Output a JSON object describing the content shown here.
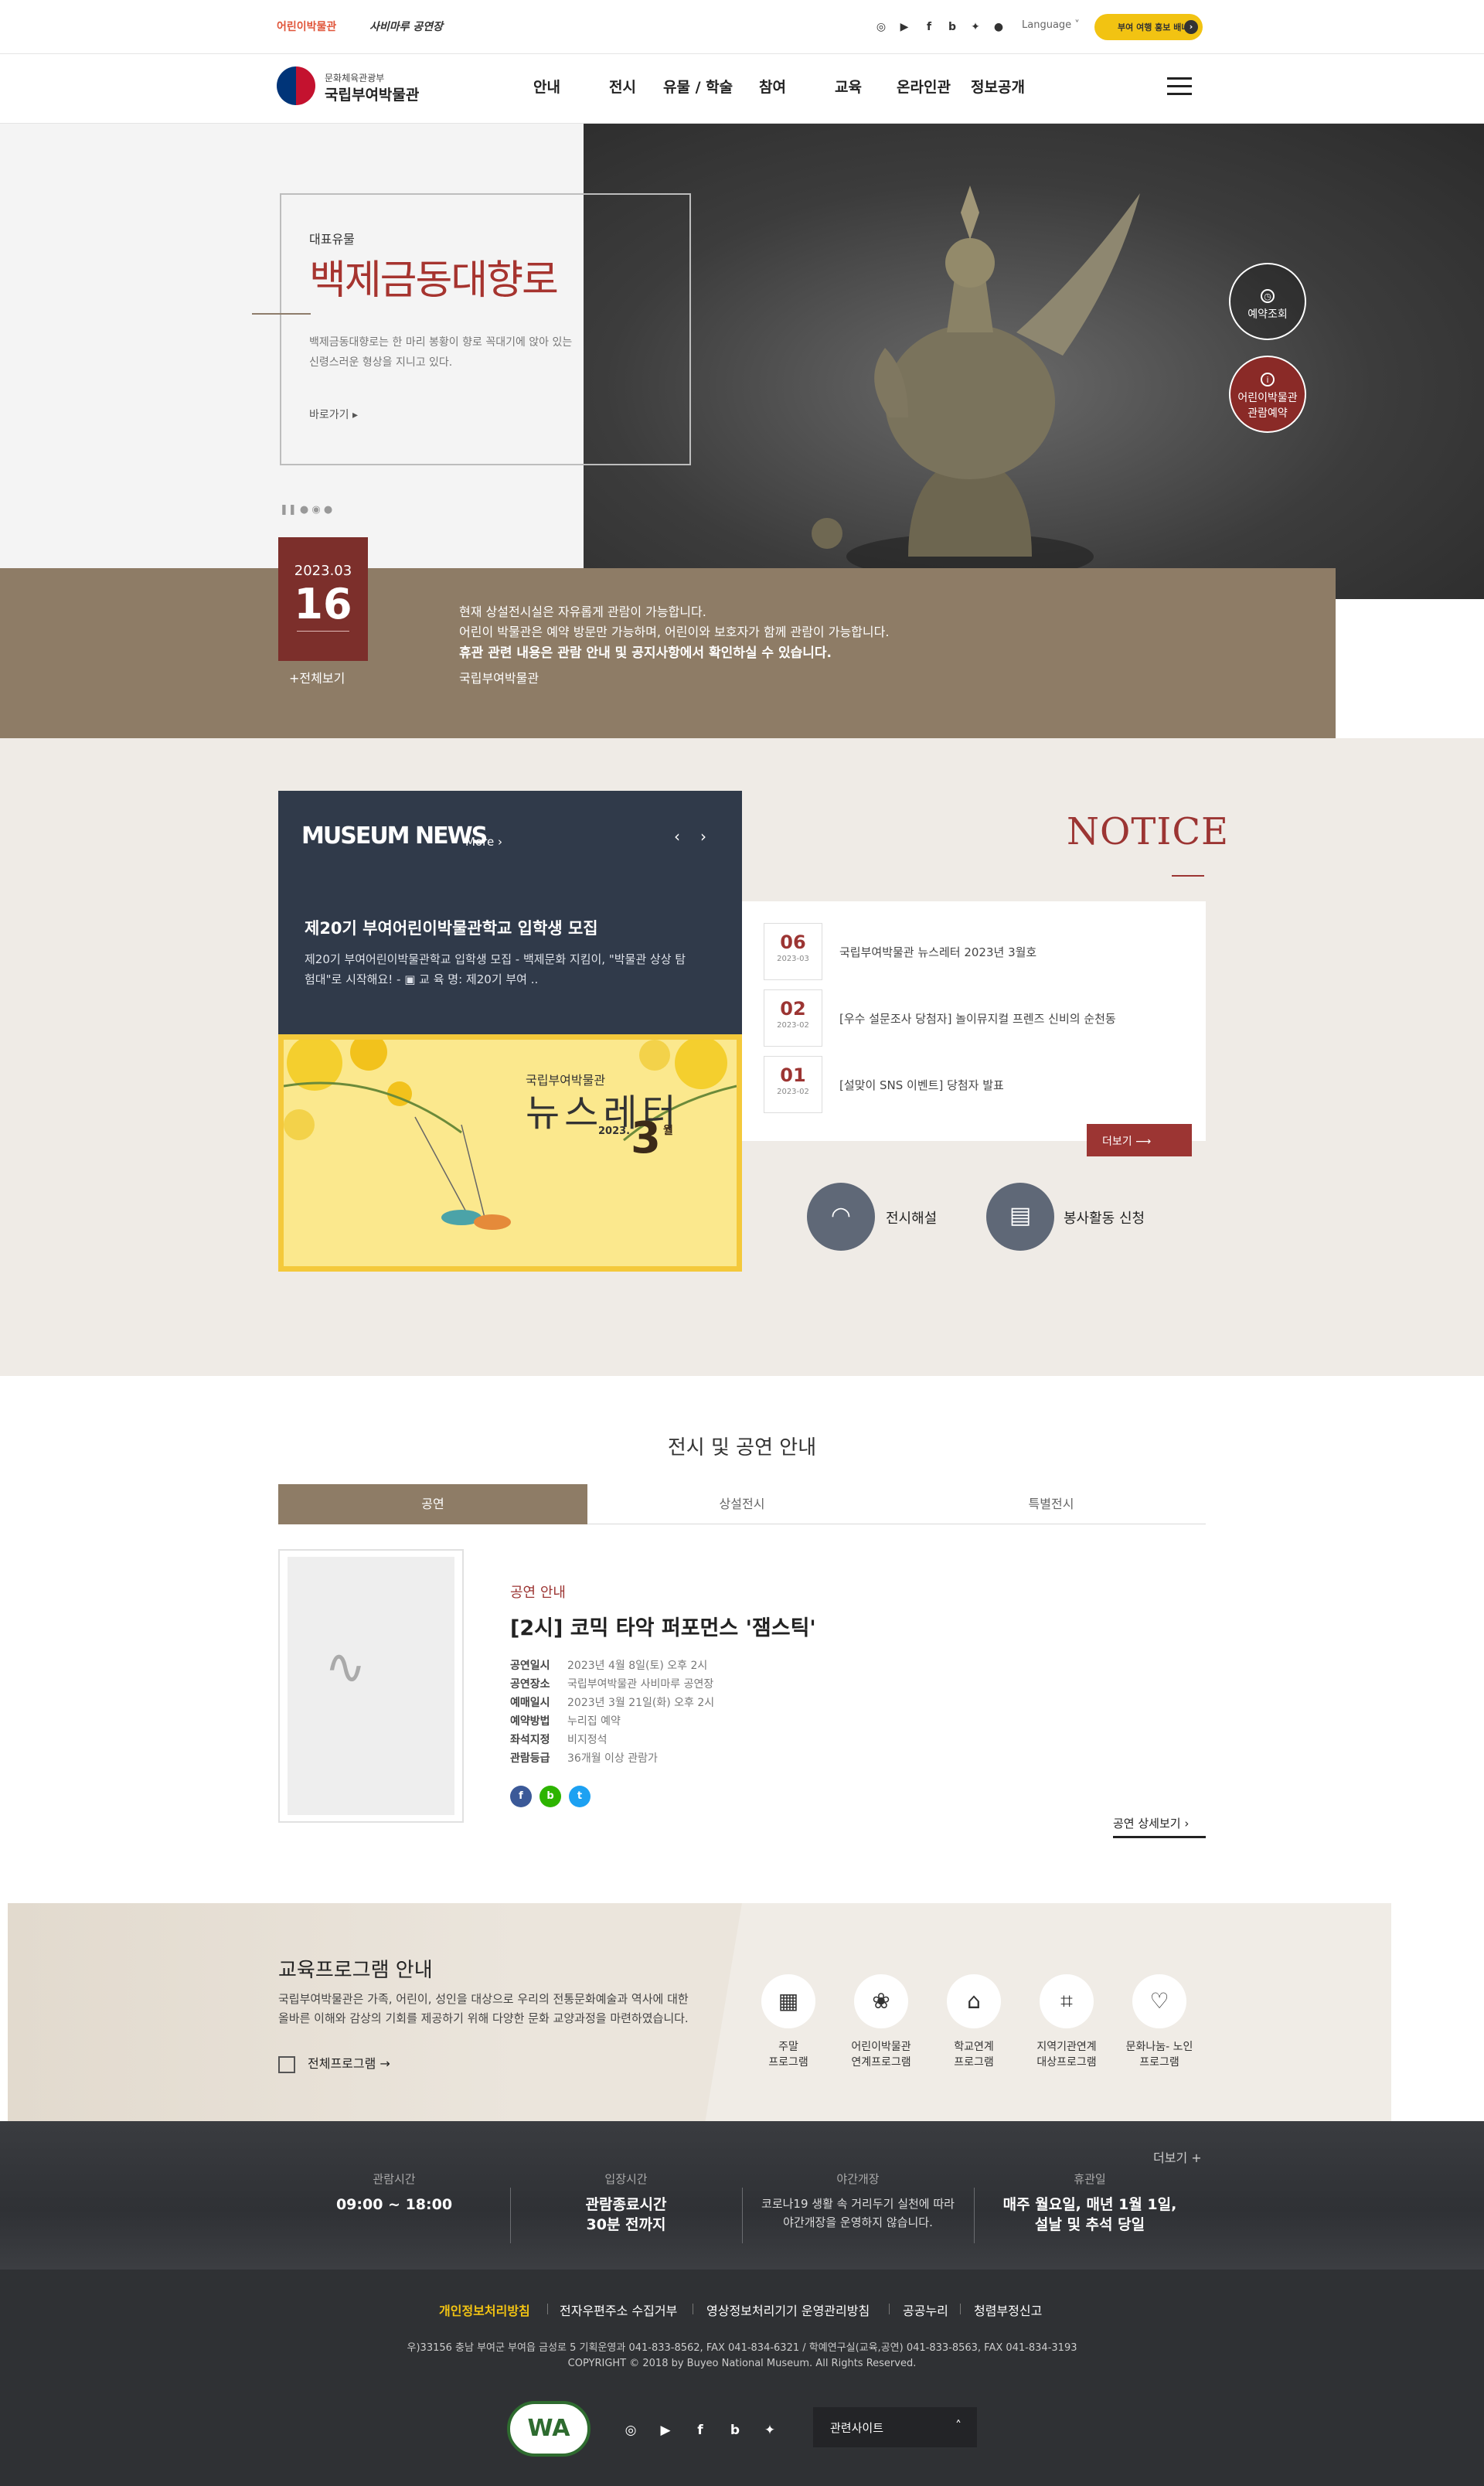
{
  "topbar": {
    "kids_link": "어린이박물관",
    "theater_link": "사비마루 공연장",
    "sns": [
      "instagram-icon",
      "youtube-icon",
      "facebook-icon",
      "blog-icon",
      "twitter-icon",
      "kakao-icon"
    ],
    "language": "Language",
    "banner": "부여 여행 홍보 배너"
  },
  "header": {
    "logo_sub": "문화체육관광부",
    "logo_main": "국립부여박물관",
    "nav": [
      "안내",
      "전시",
      "유물 / 학술",
      "참여",
      "교육",
      "온라인관",
      "정보공개"
    ]
  },
  "hero": {
    "tag": "대표유물",
    "title": "백제금동대향로",
    "desc1": "백제금동대향로는 한 마리 봉황이 향로 꼭대기에 앉아 있는",
    "desc2": "신령스러운 형상을 지니고 있다.",
    "more": "바로가기 ▸",
    "dots": "❚❚  ●  ◉  ●",
    "btn_reserve": "예약조회",
    "btn_kids1": "어린이박물관",
    "btn_kids2": "관람예약"
  },
  "notice_strip": {
    "ym": "2023.03",
    "day": "16",
    "all": "+전체보기",
    "line1": "현재 상설전시실은 자유롭게 관람이 가능합니다.",
    "line2": "어린이 박물관은 예약 방문만 가능하며, 어린이와 보호자가 함께 관람이 가능합니다.",
    "line3": "휴관 관련 내용은 관람 안내 및 공지사항에서 확인하실 수 있습니다.",
    "signature": "국립부여박물관"
  },
  "news": {
    "title": "MUSEUM NEWS",
    "more": "More ›",
    "prev": "‹",
    "next": "›",
    "headline": "제20기 부여어린이박물관학교 입학생 모집",
    "body1": "제20기 부여어린이박물관학교 입학생 모집 - 백제문화 지킴이, \"박물관 상상 탐",
    "body2": "험대\"로 시작해요! - ▣ 교 육 명: 제20기 부여 ..",
    "newsletter_small": "국립부여박물관",
    "newsletter_big": "뉴스레터",
    "newsletter_year": "2023.",
    "newsletter_month": "3",
    "newsletter_wol": "월"
  },
  "notice": {
    "title": "NOTICE",
    "items": [
      {
        "day": "06",
        "ym": "2023-03",
        "text": "국립부여박물관 뉴스레터 2023년 3월호"
      },
      {
        "day": "02",
        "ym": "2023-02",
        "text": "[우수 설문조사 당첨자] 놀이뮤지컬 프렌즈 신비의 순천동"
      },
      {
        "day": "01",
        "ym": "2023-02",
        "text": "[설맞이 SNS 이벤트] 당첨자 발표"
      }
    ],
    "more": "더보기  ⟶",
    "quick1": "전시해설",
    "quick2": "봉사활동 신청"
  },
  "exhibit": {
    "section_title": "전시 및 공연 안내",
    "tabs": [
      "공연",
      "상설전시",
      "특별전시"
    ],
    "category": "공연 안내",
    "name": "[2시] 코믹 타악 퍼포먼스 '잼스틱'",
    "rows": [
      {
        "k": "공연일시",
        "v": "2023년 4월 8일(토) 오후 2시"
      },
      {
        "k": "공연장소",
        "v": "국립부여박물관 사비마루 공연장"
      },
      {
        "k": "예매일시",
        "v": "2023년 3월 21일(화) 오후 2시"
      },
      {
        "k": "예약방법",
        "v": "누리집 예약"
      },
      {
        "k": "좌석지정",
        "v": "비지정석"
      },
      {
        "k": "관람등급",
        "v": "36개월 이상 관람가"
      }
    ],
    "share": [
      "f",
      "b",
      "t"
    ],
    "detail": "공연 상세보기 ›"
  },
  "edu": {
    "title": "교육프로그램 안내",
    "desc1": "국립부여박물관은 가족, 어린이, 성인을 대상으로 우리의 전통문화예술과 역사에 대한",
    "desc2": "올바른 이해와 감상의 기회를 제공하기 위해 다양한 문화 교양과정을 마련하였습니다.",
    "link": "전체프로그램 →",
    "items": [
      {
        "icon": "calendar-icon",
        "l1": "주말",
        "l2": "프로그램"
      },
      {
        "icon": "tree-icon",
        "l1": "어린이박물관",
        "l2": "연계프로그램"
      },
      {
        "icon": "school-icon",
        "l1": "학교연계",
        "l2": "프로그램"
      },
      {
        "icon": "graduation-cap-icon",
        "l1": "지역기관연계",
        "l2": "대상프로그램"
      },
      {
        "icon": "heart-hands-icon",
        "l1": "문화나눔- 노인",
        "l2": "프로그램"
      }
    ]
  },
  "info": {
    "more": "더보기 +",
    "cols": [
      {
        "h": "관람시간",
        "v1": "09:00 ~ 18:00",
        "v2": ""
      },
      {
        "h": "입장시간",
        "v1": "관람종료시간",
        "v2": "30분 전까지"
      },
      {
        "h": "야간개장",
        "v1": "코로나19 생활 속 거리두기 실천에 따라",
        "v2": "야간개장을 운영하지 않습니다."
      },
      {
        "h": "휴관일",
        "v1": "매주 월요일, 매년 1월 1일,",
        "v2": "설날 및 추석 당일"
      }
    ]
  },
  "footer": {
    "links": [
      "개인정보처리방침",
      "전자우편주소 수집거부",
      "영상정보처리기기 운영관리방침",
      "공공누리",
      "청렴부정신고"
    ],
    "address": "우)33156 충남 부여군 부여읍 금성로 5 기획운영과 041-833-8562, FAX 041-834-6321 / 학예연구실(교육,공연) 041-833-8563, FAX 041-834-3193",
    "copyright": "COPYRIGHT © 2018 by Buyeo National Museum. All Rights Reserved.",
    "wa_mark": "WA",
    "related": "관련사이트",
    "colors": {
      "accent": "#9c3533",
      "brown": "#8e7c66",
      "navy": "#303a4a",
      "link_hi": "#f2c312"
    }
  }
}
